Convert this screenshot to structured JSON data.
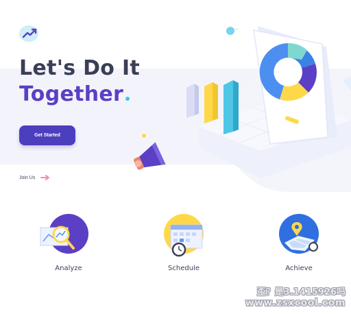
{
  "hero": {
    "headline_line1": "Let's Do It",
    "headline_line2": "Together",
    "cta_label": "Get Started",
    "join_label": "Join Us"
  },
  "colors": {
    "accent": "#5b3fc4",
    "button": "#4b3fbd",
    "text_dark": "#3a3f56",
    "cyan": "#3dc6e6",
    "yellow": "#ffd84a"
  },
  "icons": [
    "trending-up-icon",
    "arrow-right-icon",
    "magnifier-chart-icon",
    "calendar-clock-icon",
    "map-pin-icon"
  ],
  "features": [
    {
      "label": "Analyze",
      "icon": "magnifier-chart-icon"
    },
    {
      "label": "Schedule",
      "icon": "calendar-clock-icon"
    },
    {
      "label": "Achieve",
      "icon": "map-pin-icon"
    }
  ],
  "watermark": {
    "line1": "歪？是3.1415926吗",
    "line2": "www.zsxcool.com"
  }
}
